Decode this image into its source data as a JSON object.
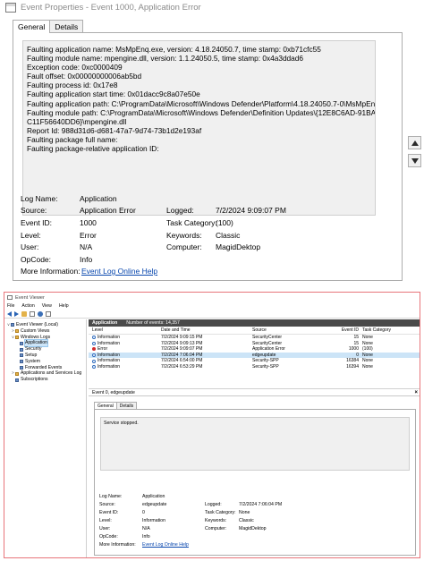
{
  "event_properties": {
    "title": "Event Properties - Event 1000, Application Error",
    "tabs": [
      "General",
      "Details"
    ],
    "description_lines": [
      "Faulting application name: MsMpEnq.exe, version: 4.18.24050.7, time stamp: 0xb71cfc55",
      "Faulting module name: mpengine.dll, version: 1.1.24050.5, time stamp: 0x4a3ddad6",
      "Exception code: 0xc0000409",
      "Fault offset: 0x00000000006ab5bd",
      "Faulting process id: 0x17e8",
      "Faulting application start time: 0x01dacc9c8a07e50e",
      "Faulting application path: C:\\ProgramData\\Microsoft\\Windows Defender\\Platform\\4.18.24050.7-0\\MsMpEnq.exe",
      "Faulting module path: C:\\ProgramData\\Microsoft\\Windows Defender\\Definition Updates\\{12E8C6AD-91BA-41A9-A577-",
      "C11F56640DD6}\\mpengine.dll",
      "Report Id: 988d31d6-d681-47a7-9d74-73b1d2e193af",
      "Faulting package full name:",
      "Faulting package-relative application ID:"
    ],
    "fields": {
      "log_name_label": "Log Name:",
      "log_name": "Application",
      "source_label": "Source:",
      "source": "Application Error",
      "logged_label": "Logged:",
      "logged": "7/2/2024 9:09:07 PM",
      "event_id_label": "Event ID:",
      "event_id": "1000",
      "task_category_label": "Task Category:",
      "task_category": "(100)",
      "level_label": "Level:",
      "level": "Error",
      "keywords_label": "Keywords:",
      "keywords": "Classic",
      "user_label": "User:",
      "user": "N/A",
      "computer_label": "Computer:",
      "computer": "MagidDektop",
      "opcode_label": "OpCode:",
      "opcode": "Info",
      "more_info_label": "More Information:",
      "more_info_link": "Event Log Online Help"
    }
  },
  "event_viewer": {
    "title": "Event Viewer",
    "menu": [
      "File",
      "Action",
      "View",
      "Help"
    ],
    "tree": [
      {
        "label": "Event Viewer (Local)",
        "depth": 0,
        "expander": "v"
      },
      {
        "label": "Custom Views",
        "depth": 1,
        "expander": ">"
      },
      {
        "label": "Windows Logs",
        "depth": 1,
        "expander": "v"
      },
      {
        "label": "Application",
        "depth": 2,
        "expander": ""
      },
      {
        "label": "Security",
        "depth": 2,
        "expander": ""
      },
      {
        "label": "Setup",
        "depth": 2,
        "expander": ""
      },
      {
        "label": "System",
        "depth": 2,
        "expander": ""
      },
      {
        "label": "Forwarded Events",
        "depth": 2,
        "expander": ""
      },
      {
        "label": "Applications and Services Log",
        "depth": 1,
        "expander": ">"
      },
      {
        "label": "Subscriptions",
        "depth": 1,
        "expander": ""
      }
    ],
    "list_header": {
      "title": "Application",
      "count": "Number of events: 14,357"
    },
    "columns": [
      "Level",
      "Date and Time",
      "Source",
      "Event ID",
      "Task Category"
    ],
    "rows": [
      {
        "level": "Information",
        "date": "7/2/2024 9:09:15 PM",
        "source": "SecurityCenter",
        "id": "15",
        "task": "None"
      },
      {
        "level": "Information",
        "date": "7/2/2024 9:09:13 PM",
        "source": "SecurityCenter",
        "id": "15",
        "task": "None"
      },
      {
        "level": "Error",
        "date": "7/2/2024 9:09:07 PM",
        "source": "Application Error",
        "id": "1000",
        "task": "(100)"
      },
      {
        "level": "Information",
        "date": "7/2/2024 7:06:04 PM",
        "source": "edgeupdate",
        "id": "0",
        "task": "None"
      },
      {
        "level": "Information",
        "date": "7/2/2024 6:54:00 PM",
        "source": "Security-SPP",
        "id": "16384",
        "task": "None"
      },
      {
        "level": "Information",
        "date": "7/2/2024 6:53:29 PM",
        "source": "Security-SPP",
        "id": "16394",
        "task": "None"
      }
    ],
    "selected_row": 3,
    "detail_header": "Event 0, edgeupdate",
    "detail_tabs": [
      "General",
      "Details"
    ],
    "detail_description": "Service stopped.",
    "detail_fields": {
      "log_name_label": "Log Name:",
      "log_name": "Application",
      "source_label": "Source:",
      "source": "edgeupdate",
      "logged_label": "Logged:",
      "logged": "7/2/2024 7:06:04 PM",
      "event_id_label": "Event ID:",
      "event_id": "0",
      "task_category_label": "Task Category:",
      "task_category": "None",
      "level_label": "Level:",
      "level": "Information",
      "keywords_label": "Keywords:",
      "keywords": "Classic",
      "user_label": "User:",
      "user": "N/A",
      "computer_label": "Computer:",
      "computer": "MagidDektop",
      "opcode_label": "OpCode:",
      "opcode": "Info",
      "more_info_label": "More Information:",
      "more_info_link": "Event Log Online Help"
    }
  },
  "colors": {
    "link": "#0645ad",
    "selection": "#cce4f7",
    "header_dark": "#4a4a4a",
    "border_accent": "#e8757a",
    "error": "#d22b2b"
  }
}
